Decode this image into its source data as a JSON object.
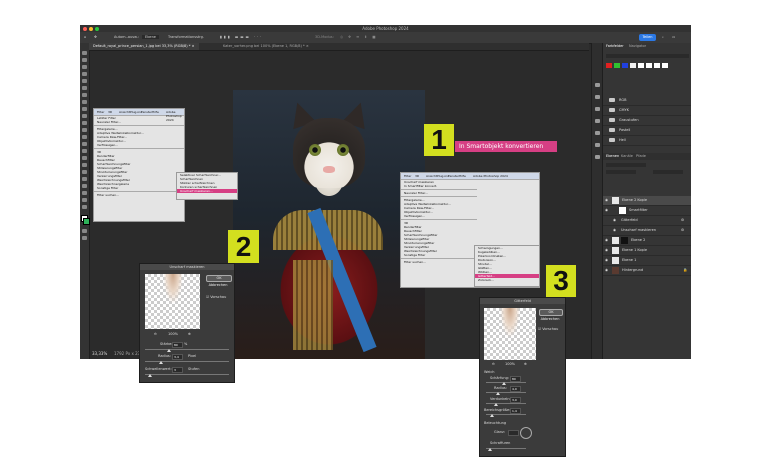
{
  "window": {
    "title": "Adobe Photoshop 2024",
    "share_label": "Teilen",
    "options": {
      "auto_select": "Autom.-ausw.:",
      "layer_dropdown": "Ebene",
      "transform_controls": "Transformationsstrg.",
      "mode_3d": "3D-Modus:"
    }
  },
  "tabs": [
    {
      "label": "Default_royal_prince_persian_1.jpg bei 33,3% (RGB/8) *"
    },
    {
      "label": "Kater_vorher.png bei 100% (Ebene 1, RGB/8) *"
    }
  ],
  "status": {
    "zoom": "33,33%",
    "info": "1792 Px x 2304 Px (72 ppi)"
  },
  "right_panel": {
    "tabs": [
      "Farbfelder",
      "Navigator"
    ],
    "swatch_colors": [
      "#e02020",
      "#30c030",
      "#2040e0",
      "#f0f0f0",
      "#ffffff",
      "#ffffff",
      "#ffffff",
      "#ffffff"
    ],
    "folders": [
      "RGB",
      "CMYK",
      "Graustufen",
      "Pastell",
      "Hell"
    ],
    "layer_tabs": [
      "Ebenen",
      "Kanäle",
      "Pfade"
    ],
    "layers": [
      {
        "name": "Ebene 2 Kopie",
        "indent": 0
      },
      {
        "name": "Smartfilter",
        "indent": 2
      },
      {
        "name": "Gitterfeld",
        "indent": 3
      },
      {
        "name": "Unscharf maskieren",
        "indent": 3
      },
      {
        "name": "Ebene 2",
        "indent": 1
      },
      {
        "name": "Ebene 1 Kopie",
        "indent": 0
      },
      {
        "name": "Ebene 1",
        "indent": 0
      },
      {
        "name": "Hintergrund",
        "indent": 0
      }
    ]
  },
  "menu1": {
    "bar_items": [
      "Filter",
      "3D",
      "Ansicht",
      "Plug-ins",
      "Fenster",
      "Hilfe"
    ],
    "header": "Adobe Photoshop 2024",
    "items": [
      "Letzter Filter",
      "Neuraler Filter...",
      "",
      "Filtergalerie...",
      "Adaptive Weitwinkelkorrektur...",
      "Camera Raw-Filter...",
      "Objektivkorrektur...",
      "Verflüssigen...",
      "",
      "3D",
      "Renderfilter",
      "Rauschfilter",
      "Scharfzeichnungsfilter",
      "Stilisierungsfilter",
      "Strukturierungsfilter",
      "Verzerrungsfilter",
      "Weichzeichnungsfilter",
      "Weichzeichnergalerie",
      "Sonstige Filter",
      "",
      "Filter suchen..."
    ],
    "submenu": [
      "Selektiver Scharfzeichner...",
      "Scharfzeichnen",
      "Stärker scharfzeichnen",
      "Konturen scharfzeichnen",
      "Unscharf maskieren..."
    ],
    "highlight": "Unscharf maskieren..."
  },
  "menu3": {
    "bar_items": [
      "Filter",
      "3D",
      "Ansicht",
      "Plug-ins",
      "Fenster",
      "Hilfe"
    ],
    "header": "Adobe Photoshop 2024",
    "items": [
      "Unscharf maskieren",
      "In Smartfilter konvert.",
      "",
      "Neuraler Filter...",
      "",
      "Filtergalerie...",
      "Adaptive Weitwinkelkorrektur...",
      "Camera Raw-Filter...",
      "Objektivkorrektur...",
      "Verflüssigen...",
      "",
      "3D",
      "Renderfilter",
      "Rauschfilter",
      "Scharfzeichnungsfilter",
      "Stilisierungsfilter",
      "Strukturierungsfilter",
      "Verzerrungsfilter",
      "Weichzeichnungsfilter",
      "Sonstige Filter",
      "",
      "Filter suchen..."
    ],
    "submenu": [
      "Schwingungen...",
      "Kugelwölben...",
      "Polarkoordinaten...",
      "Distorsion...",
      "Strudel...",
      "Glätten...",
      "Wölben...",
      "Gitterfeld...",
      "Zickzack..."
    ],
    "highlight": "Gitterfeld..."
  },
  "callouts": [
    {
      "number": "1"
    },
    {
      "number": "2"
    },
    {
      "number": "3"
    }
  ],
  "smart_label": "In Smartobjekt konvertieren",
  "dialog2": {
    "title": "Unscharf maskieren",
    "ok": "OK",
    "cancel": "Abbrechen",
    "preview": "Vorschau",
    "zoom": "100%",
    "amount_label": "Stärke:",
    "amount_value": "80",
    "amount_unit": "%",
    "radius_label": "Radius:",
    "radius_value": "3,4",
    "radius_unit": "Pixel",
    "threshold_label": "Schwellenwert:",
    "threshold_value": "3",
    "threshold_unit": "Stufen"
  },
  "dialog3": {
    "title": "Gitterfeld",
    "ok": "OK",
    "cancel": "Abbrechen",
    "preview": "Vorschau",
    "zoom": "100%",
    "section_soft": "Weich",
    "rows": [
      {
        "label": "Schärfung:",
        "value": "80"
      },
      {
        "label": "Radius:",
        "value": "4,0"
      },
      {
        "label": "Verdunkeln:",
        "value": "3,0"
      },
      {
        "label": "Bereichsgröße:",
        "value": "1,4"
      }
    ],
    "section_lighting": "Beleuchtung",
    "gloss_label": "Glanz:",
    "angle_label": "Schraffuren"
  }
}
